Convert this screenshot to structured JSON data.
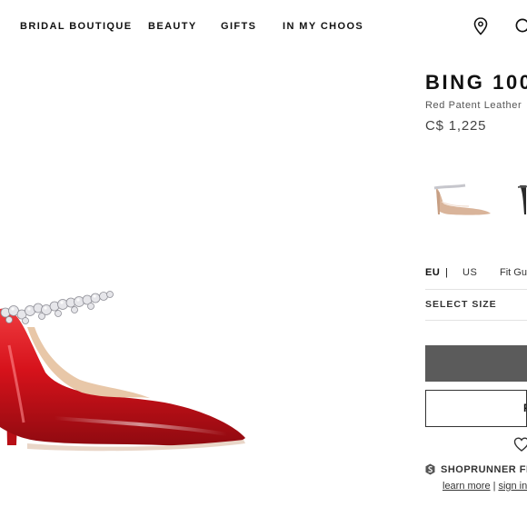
{
  "nav": {
    "items": [
      {
        "label": "BRIDAL BOUTIQUE"
      },
      {
        "label": "BEAUTY"
      },
      {
        "label": "GIFTS"
      },
      {
        "label": "IN MY CHOOS"
      }
    ],
    "store_icon": "map-pin-icon",
    "search_icon": "search-icon"
  },
  "product": {
    "title": "BING 100",
    "subtitle": "Red Patent Leather",
    "price": "C$ 1,225",
    "color": "#d6121b"
  },
  "thumbnails": [
    {
      "icon": "nude-mule-thumbnail"
    },
    {
      "icon": "black-mule-thumbnail"
    }
  ],
  "size": {
    "unit_eu": "EU",
    "separator": "|",
    "unit_us": "US",
    "fit_guide": "Fit Gu",
    "select_label": "SELECT SIZE"
  },
  "actions": {
    "secondary_label_fragment": "F",
    "wishlist_icon": "heart-icon"
  },
  "shoprunner": {
    "label": "SHOPRUNNER FR",
    "learn_more": "learn more",
    "links_separator": "|",
    "sign_in": "sign in"
  }
}
